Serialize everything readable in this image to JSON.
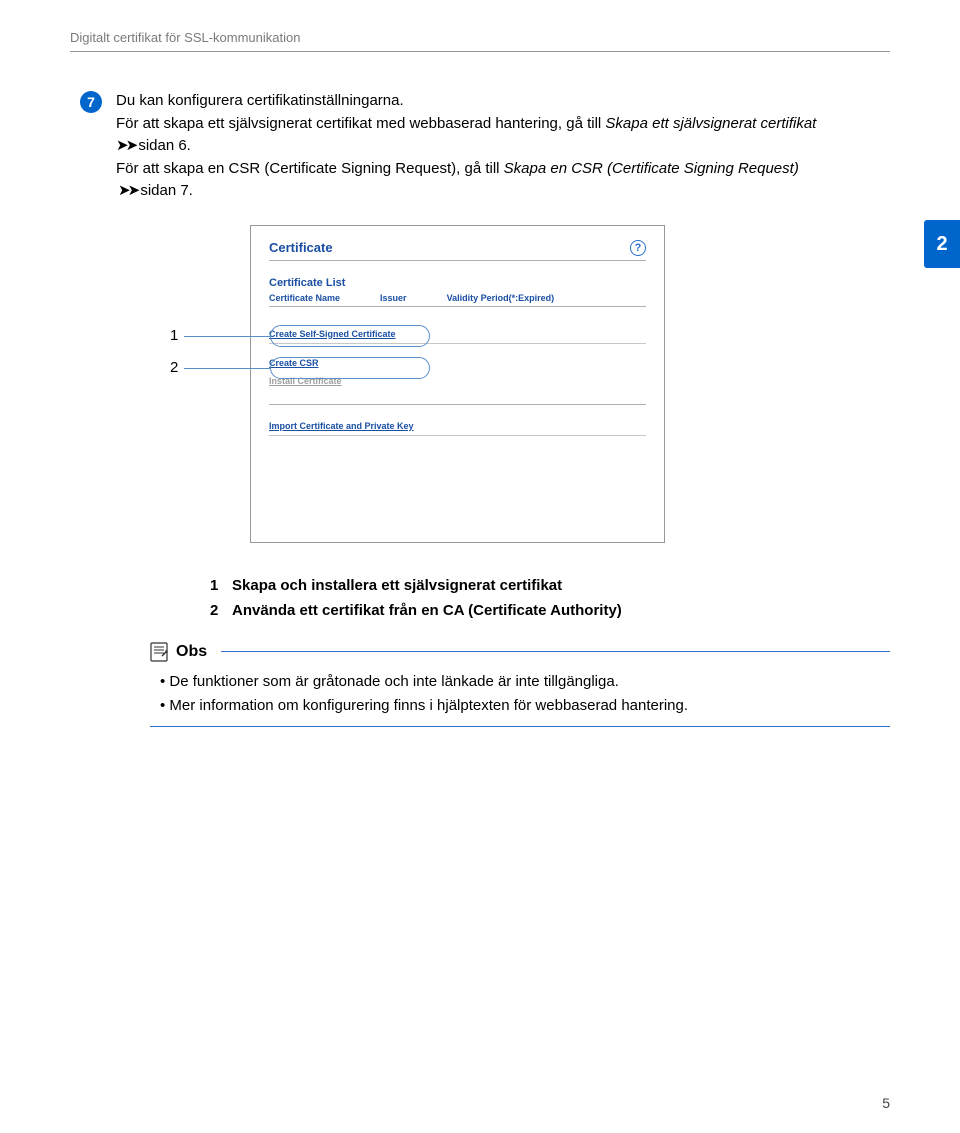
{
  "header": {
    "title": "Digitalt certifikat för SSL-kommunikation"
  },
  "step": {
    "number": "7",
    "line1": "Du kan konfigurera certifikatinställningarna.",
    "line2a": "För att skapa ett självsignerat certifikat med webbaserad hantering, gå till ",
    "line2b": "Skapa ett självsignerat certifikat",
    "line2c": " sidan 6.",
    "line3a": "För att skapa en CSR (Certificate Signing Request), gå till ",
    "line3b": "Skapa en CSR (Certificate Signing Request)",
    "line3c": " sidan 7."
  },
  "chapter": "2",
  "panel": {
    "title": "Certificate",
    "section1": "Certificate List",
    "col1": "Certificate Name",
    "col2": "Issuer",
    "col3": "Validity Period(*:Expired)",
    "link_self_signed": "Create Self-Signed Certificate",
    "link_csr": "Create CSR",
    "link_install": "Install Certificate",
    "link_import": "Import Certificate and Private Key"
  },
  "callouts": {
    "c1": "1",
    "c2": "2"
  },
  "legend": {
    "item1_num": "1",
    "item1_text": "Skapa och installera ett självsignerat certifikat",
    "item2_num": "2",
    "item2_text": "Använda ett certifikat från en CA (Certificate Authority)"
  },
  "obs": {
    "label": "Obs",
    "note1": "De funktioner som är gråtonade och inte länkade är inte tillgängliga.",
    "note2": "Mer information om konfigurering finns i hjälptexten för webbaserad hantering."
  },
  "page_number": "5"
}
